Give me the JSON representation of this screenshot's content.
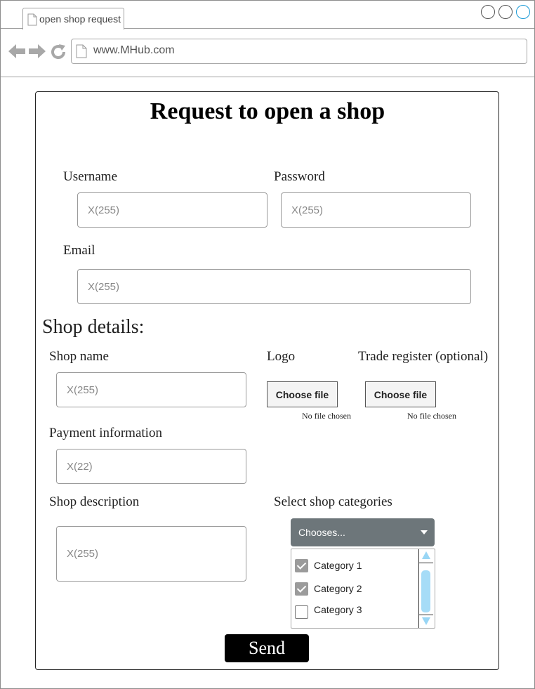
{
  "browser": {
    "tab_title": "open shop request",
    "url": "www.MHub.com"
  },
  "form": {
    "title": "Request to open a shop",
    "username_label": "Username",
    "username_placeholder": "X(255)",
    "password_label": "Password",
    "password_placeholder": "X(255)",
    "email_label": "Email",
    "email_placeholder": "X(255)",
    "section_heading": "Shop details:",
    "shop_name_label": "Shop name",
    "shop_name_placeholder": "X(255)",
    "logo_label": "Logo",
    "logo_button": "Choose file",
    "logo_status": "No file chosen",
    "trade_label": "Trade register (optional)",
    "trade_button": "Choose file",
    "trade_status": "No file chosen",
    "payment_label": "Payment information",
    "payment_placeholder": "X(22)",
    "description_label": "Shop description",
    "description_placeholder": "X(255)",
    "categories_label": "Select shop categories",
    "categories_select": "Chooses...",
    "categories": [
      {
        "label": "Category 1",
        "checked": true
      },
      {
        "label": "Category 2",
        "checked": true
      },
      {
        "label": "Category 3",
        "checked": false
      }
    ],
    "send_button": "Send"
  }
}
